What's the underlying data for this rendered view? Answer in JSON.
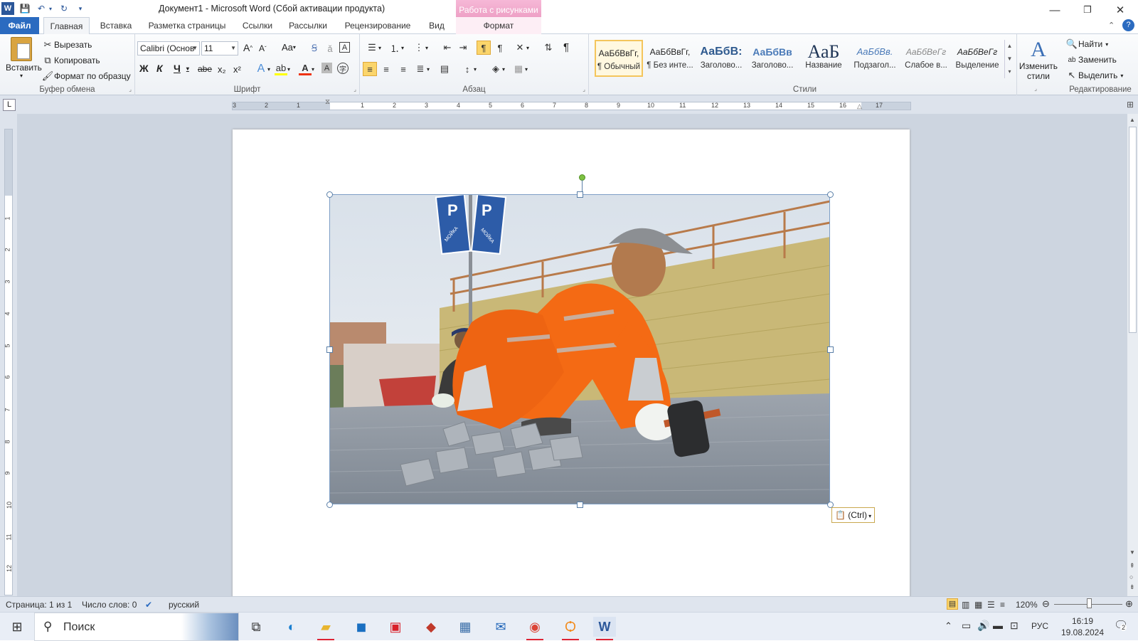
{
  "window": {
    "title": "Документ1  -  Microsoft Word (Сбой активации продукта)",
    "context_tab_group": "Работа с рисунками",
    "controls": [
      "minimize",
      "restore",
      "close"
    ]
  },
  "tabs": [
    {
      "label": "Файл"
    },
    {
      "label": "Главная"
    },
    {
      "label": "Вставка"
    },
    {
      "label": "Разметка страницы"
    },
    {
      "label": "Ссылки"
    },
    {
      "label": "Рассылки"
    },
    {
      "label": "Рецензирование"
    },
    {
      "label": "Вид"
    },
    {
      "label": "Формат"
    }
  ],
  "active_tab": "Главная",
  "clipboard": {
    "paste": "Вставить",
    "cut": "Вырезать",
    "copy": "Копировать",
    "format_painter": "Формат по образцу",
    "group_label": "Буфер обмена"
  },
  "font": {
    "name": "Calibri (Основ",
    "size": "11",
    "bold": "Ж",
    "italic": "К",
    "underline": "Ч",
    "strike": "abe",
    "subscript": "x₂",
    "superscript": "x²",
    "grow": "A",
    "shrink": "A",
    "change_case": "Aa",
    "group_label": "Шрифт"
  },
  "paragraph": {
    "group_label": "Абзац",
    "pilcrow": "¶"
  },
  "styles": {
    "group_label": "Стили",
    "items": [
      {
        "sample": "АаБбВвГг,",
        "name": "¶ Обычный"
      },
      {
        "sample": "АаБбВвГг,",
        "name": "¶ Без инте..."
      },
      {
        "sample": "АаБбВ:",
        "name": "Заголово..."
      },
      {
        "sample": "АаБбВв",
        "name": "Заголово..."
      },
      {
        "sample": "АаБ",
        "name": "Название"
      },
      {
        "sample": "АаБбВв.",
        "name": "Подзагол..."
      },
      {
        "sample": "АаБбВеГг",
        "name": "Слабое в..."
      },
      {
        "sample": "АаБбВеГг",
        "name": "Выделение"
      }
    ],
    "change_styles": "Изменить стили"
  },
  "editing": {
    "group_label": "Редактирование",
    "find": "Найти",
    "replace": "Заменить",
    "select": "Выделить"
  },
  "ruler": {
    "h_numbers": [
      "3",
      "2",
      "1",
      "1",
      "2",
      "3",
      "4",
      "5",
      "6",
      "7",
      "8",
      "9",
      "10",
      "11",
      "12",
      "13",
      "14",
      "15",
      "16",
      "17"
    ],
    "v_numbers": [
      "1",
      "2",
      "3",
      "4",
      "5",
      "6",
      "7",
      "8",
      "9",
      "10",
      "11",
      "12"
    ]
  },
  "image": {
    "signs": [
      "P",
      "P",
      "МОЙКА",
      "МОЙКА"
    ]
  },
  "paste_options": "(Ctrl)",
  "status": {
    "page": "Страница: 1 из 1",
    "words": "Число слов: 0",
    "language": "русский",
    "zoom": "120%"
  },
  "taskbar": {
    "search": "Поиск",
    "lang": "РУС",
    "time": "16:19",
    "date": "19.08.2024",
    "notifications": "2"
  }
}
